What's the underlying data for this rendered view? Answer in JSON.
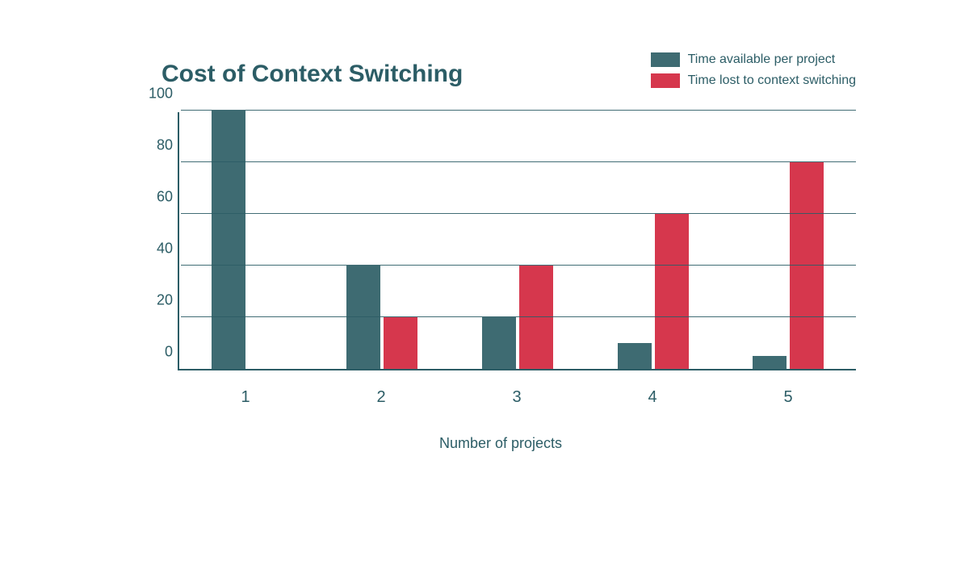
{
  "chart_data": {
    "type": "bar",
    "title": "Cost of Context Switching",
    "xlabel": "Number of projects",
    "ylabel": "",
    "categories": [
      "1",
      "2",
      "3",
      "4",
      "5"
    ],
    "series": [
      {
        "name": "Time available per project",
        "values": [
          100,
          40,
          20,
          10,
          5
        ],
        "color": "#3e6b72"
      },
      {
        "name": "Time lost to context switching",
        "values": [
          0,
          20,
          40,
          60,
          80
        ],
        "color": "#d6374d"
      }
    ],
    "ylim": [
      0,
      100
    ],
    "y_ticks": [
      0,
      20,
      40,
      60,
      80,
      100
    ],
    "legend_position": "top-right",
    "grid": true
  },
  "colors": {
    "axis": "#2c5d66",
    "text": "#2c5d66"
  }
}
